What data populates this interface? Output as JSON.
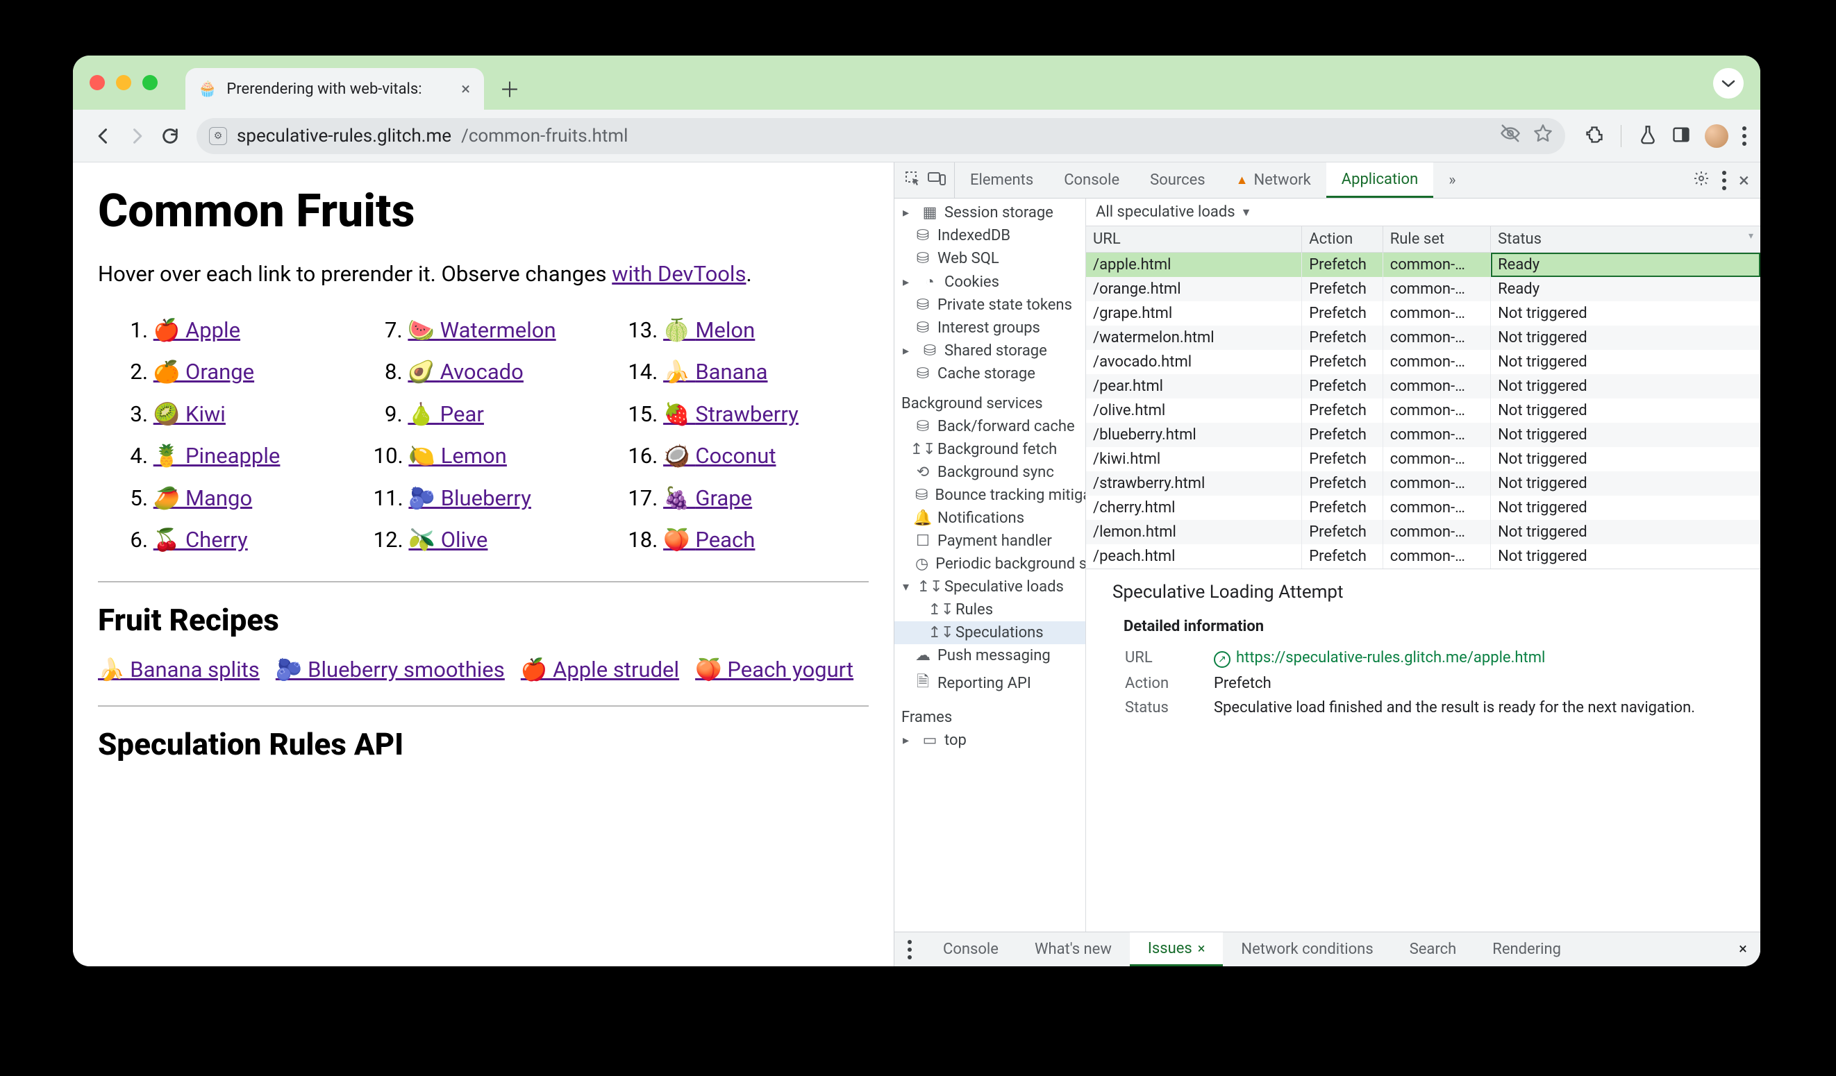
{
  "browser": {
    "tab_title": "Prerendering with web-vitals:",
    "url_host": "speculative-rules.glitch.me",
    "url_path": "/common-fruits.html"
  },
  "page": {
    "h1": "Common Fruits",
    "intro_pre": "Hover over each link to prerender it. Observe changes ",
    "intro_link": "with DevTools",
    "intro_post": ".",
    "fruits": [
      {
        "n": "1.",
        "e": "🍎",
        "t": "Apple"
      },
      {
        "n": "2.",
        "e": "🍊",
        "t": "Orange"
      },
      {
        "n": "3.",
        "e": "🥝",
        "t": "Kiwi"
      },
      {
        "n": "4.",
        "e": "🍍",
        "t": "Pineapple"
      },
      {
        "n": "5.",
        "e": "🥭",
        "t": "Mango"
      },
      {
        "n": "6.",
        "e": "🍒",
        "t": "Cherry"
      },
      {
        "n": "7.",
        "e": "🍉",
        "t": "Watermelon"
      },
      {
        "n": "8.",
        "e": "🥑",
        "t": "Avocado"
      },
      {
        "n": "9.",
        "e": "🍐",
        "t": "Pear"
      },
      {
        "n": "10.",
        "e": "🍋",
        "t": "Lemon"
      },
      {
        "n": "11.",
        "e": "🫐",
        "t": "Blueberry"
      },
      {
        "n": "12.",
        "e": "🫒",
        "t": "Olive"
      },
      {
        "n": "13.",
        "e": "🍈",
        "t": "Melon"
      },
      {
        "n": "14.",
        "e": "🍌",
        "t": "Banana"
      },
      {
        "n": "15.",
        "e": "🍓",
        "t": "Strawberry"
      },
      {
        "n": "16.",
        "e": "🥥",
        "t": "Coconut"
      },
      {
        "n": "17.",
        "e": "🍇",
        "t": "Grape"
      },
      {
        "n": "18.",
        "e": "🍑",
        "t": "Peach"
      }
    ],
    "h2_recipes": "Fruit Recipes",
    "recipes": [
      {
        "e": "🍌",
        "t": "Banana splits"
      },
      {
        "e": "🫐",
        "t": "Blueberry smoothies"
      },
      {
        "e": "🍎",
        "t": "Apple strudel"
      },
      {
        "e": "🍑",
        "t": "Peach yogurt"
      }
    ],
    "h2_api": "Speculation Rules API"
  },
  "devtools": {
    "tabs": [
      "Elements",
      "Console",
      "Sources",
      "Network",
      "Application"
    ],
    "tabs_warn_index": 3,
    "tabs_active_index": 4,
    "sidebar_top": [
      {
        "i": "▦",
        "t": "Session storage",
        "tri": true
      },
      {
        "i": "⛁",
        "t": "IndexedDB"
      },
      {
        "i": "⛁",
        "t": "Web SQL"
      },
      {
        "i": "◔",
        "t": "Cookies",
        "tri": true
      },
      {
        "i": "⛁",
        "t": "Private state tokens"
      },
      {
        "i": "⛁",
        "t": "Interest groups"
      },
      {
        "i": "⛁",
        "t": "Shared storage",
        "tri": true
      },
      {
        "i": "⛁",
        "t": "Cache storage"
      }
    ],
    "sidebar_bg_title": "Background services",
    "sidebar_bg": [
      {
        "i": "⛁",
        "t": "Back/forward cache"
      },
      {
        "i": "↥↧",
        "t": "Background fetch"
      },
      {
        "i": "⟲",
        "t": "Background sync"
      },
      {
        "i": "⛁",
        "t": "Bounce tracking mitigations"
      },
      {
        "i": "🔔",
        "t": "Notifications"
      },
      {
        "i": "☐",
        "t": "Payment handler"
      },
      {
        "i": "◷",
        "t": "Periodic background sync"
      },
      {
        "i": "↥↧",
        "t": "Speculative loads",
        "tri": true,
        "open": true
      },
      {
        "i": "↥↧",
        "t": "Rules",
        "l2": true
      },
      {
        "i": "↥↧",
        "t": "Speculations",
        "l2": true,
        "sel": true
      },
      {
        "i": "☁",
        "t": "Push messaging"
      },
      {
        "i": "🗎",
        "t": "Reporting API"
      }
    ],
    "sidebar_frames_title": "Frames",
    "sidebar_frames": [
      {
        "i": "▭",
        "t": "top",
        "tri": true
      }
    ],
    "filter_label": "All speculative loads",
    "columns": [
      "URL",
      "Action",
      "Rule set",
      "Status"
    ],
    "rows": [
      {
        "url": "/apple.html",
        "action": "Prefetch",
        "rule": "common-…",
        "status": "Ready",
        "sel": true
      },
      {
        "url": "/orange.html",
        "action": "Prefetch",
        "rule": "common-…",
        "status": "Ready"
      },
      {
        "url": "/grape.html",
        "action": "Prefetch",
        "rule": "common-…",
        "status": "Not triggered"
      },
      {
        "url": "/watermelon.html",
        "action": "Prefetch",
        "rule": "common-…",
        "status": "Not triggered"
      },
      {
        "url": "/avocado.html",
        "action": "Prefetch",
        "rule": "common-…",
        "status": "Not triggered"
      },
      {
        "url": "/pear.html",
        "action": "Prefetch",
        "rule": "common-…",
        "status": "Not triggered"
      },
      {
        "url": "/olive.html",
        "action": "Prefetch",
        "rule": "common-…",
        "status": "Not triggered"
      },
      {
        "url": "/blueberry.html",
        "action": "Prefetch",
        "rule": "common-…",
        "status": "Not triggered"
      },
      {
        "url": "/kiwi.html",
        "action": "Prefetch",
        "rule": "common-…",
        "status": "Not triggered"
      },
      {
        "url": "/strawberry.html",
        "action": "Prefetch",
        "rule": "common-…",
        "status": "Not triggered"
      },
      {
        "url": "/cherry.html",
        "action": "Prefetch",
        "rule": "common-…",
        "status": "Not triggered"
      },
      {
        "url": "/lemon.html",
        "action": "Prefetch",
        "rule": "common-…",
        "status": "Not triggered"
      },
      {
        "url": "/peach.html",
        "action": "Prefetch",
        "rule": "common-…",
        "status": "Not triggered"
      }
    ],
    "detail": {
      "title": "Speculative Loading Attempt",
      "section": "Detailed information",
      "url_label": "URL",
      "url": "https://speculative-rules.glitch.me/apple.html",
      "action_label": "Action",
      "action": "Prefetch",
      "status_label": "Status",
      "status": "Speculative load finished and the result is ready for the next navigation."
    },
    "drawer": [
      "Console",
      "What's new",
      "Issues",
      "Network conditions",
      "Search",
      "Rendering"
    ],
    "drawer_active_index": 2
  }
}
